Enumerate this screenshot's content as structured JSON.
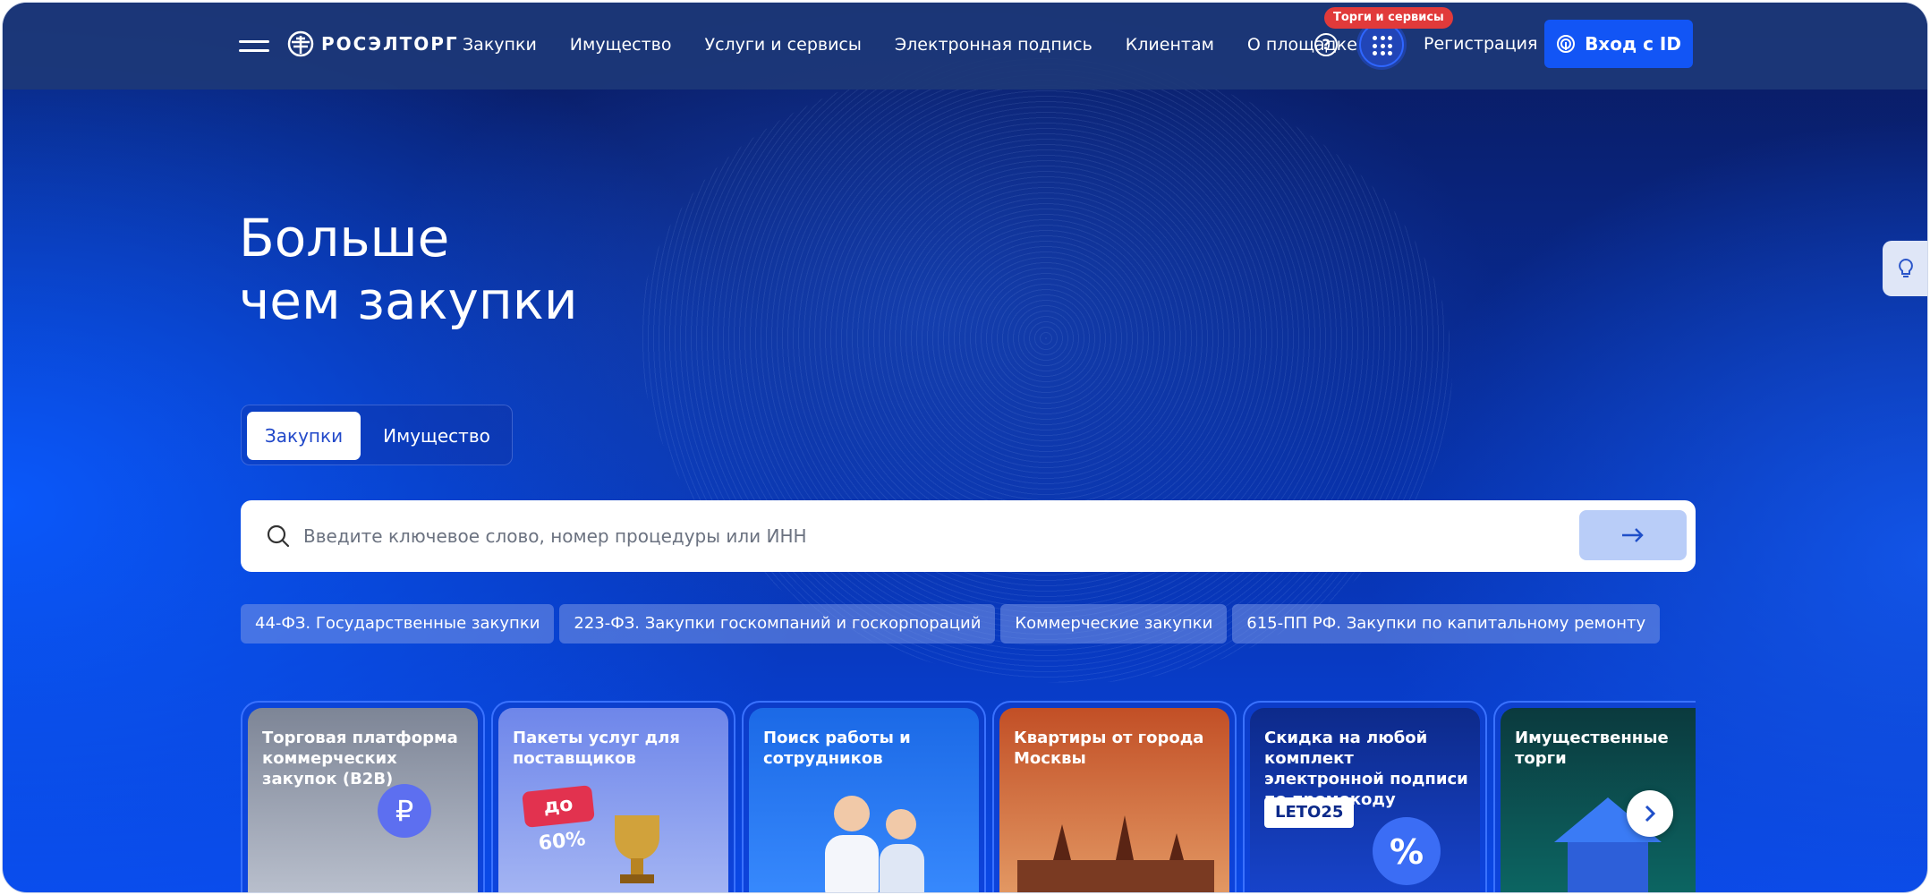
{
  "header": {
    "logo_text": "РОСЭЛТОРГ",
    "nav": [
      "Закупки",
      "Имущество",
      "Услуги и сервисы",
      "Электронная подпись",
      "Клиентам",
      "О площадке"
    ],
    "help_label": "?",
    "apps_badge": "Торги и сервисы",
    "register_label": "Регистрация",
    "login_label": "Вход с ID"
  },
  "hero": {
    "title_line1": "Больше",
    "title_line2": "чем закупки"
  },
  "tabs": [
    {
      "label": "Закупки",
      "active": true
    },
    {
      "label": "Имущество",
      "active": false
    }
  ],
  "search": {
    "placeholder": "Введите ключевое слово, номер процедуры или ИНН",
    "submit_icon": "arrow-right-icon"
  },
  "chips": [
    "44-ФЗ. Государственные закупки",
    "223-ФЗ. Закупки госкомпаний и госкорпораций",
    "Коммерческие закупки",
    "615-ПП РФ. Закупки по капитальному ремонту"
  ],
  "cards": [
    {
      "title": "Торговая платформа коммерческих закупок (B2B)"
    },
    {
      "title": "Пакеты услуг для поставщиков",
      "badge": "до 60%"
    },
    {
      "title": "Поиск работы и сотрудников"
    },
    {
      "title": "Квартиры от города Москвы"
    },
    {
      "title": "Скидка на любой комплект электронной подписи по промокоду",
      "promo": "LETO25"
    },
    {
      "title": "Имущественные торги"
    }
  ],
  "colors": {
    "accent": "#1255f5",
    "header_bg": "#1d3878",
    "badge_red": "#e13a3a"
  }
}
